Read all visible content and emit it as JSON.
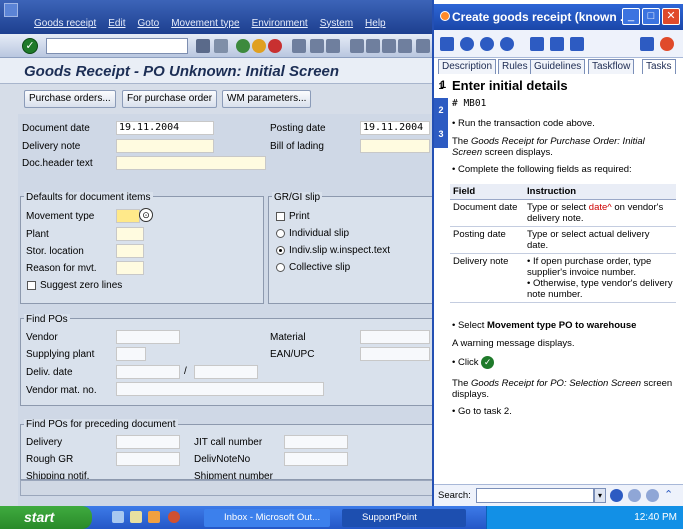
{
  "sap": {
    "menu": [
      "Goods receipt",
      "Edit",
      "Goto",
      "Movement type",
      "Environment",
      "System",
      "Help"
    ],
    "heading": "Goods Receipt - PO Unknown: Initial Screen",
    "buttons": [
      "Purchase orders...",
      "For purchase order",
      "WM parameters..."
    ],
    "fields": {
      "document_date_label": "Document date",
      "document_date": "19.11.2004",
      "posting_date_label": "Posting date",
      "posting_date": "19.11.2004",
      "delivery_note_label": "Delivery note",
      "bill_of_lading_label": "Bill of lading",
      "doc_header_label": "Doc.header text"
    },
    "defaults": {
      "title": "Defaults for document items",
      "movement_type": "Movement type",
      "plant": "Plant",
      "stor_location": "Stor. location",
      "reason": "Reason for mvt.",
      "suggest_zero": "Suggest zero lines"
    },
    "grgi": {
      "title": "GR/GI slip",
      "print": "Print",
      "individual": "Individual slip",
      "indiv_inspect": "Indiv.slip w.inspect.text",
      "collective": "Collective slip"
    },
    "find_pos": {
      "title": "Find POs",
      "vendor": "Vendor",
      "material": "Material",
      "supplying_plant": "Supplying plant",
      "ean": "EAN/UPC",
      "deliv_date": "Deliv. date",
      "slash": "/",
      "vendor_mat": "Vendor mat. no."
    },
    "find_preceding": {
      "title": "Find POs for preceding document",
      "delivery": "Delivery",
      "jit": "JIT call number",
      "rough_gr": "Rough GR",
      "delivnote": "DelivNoteNo",
      "shipping": "Shipping notif.",
      "shipment": "Shipment number"
    }
  },
  "help": {
    "title": "Create goods receipt (known ...",
    "tabs": [
      "Description",
      "Rules",
      "Guidelines",
      "Taskflow",
      "Tasks"
    ],
    "task_nums": [
      "1",
      "2",
      "3"
    ],
    "heading_num": "1",
    "heading": "Enter initial details",
    "tcode": "MB01",
    "run": "Run the transaction code above.",
    "the": "The ",
    "screen_name": "Goods Receipt for Purchase Order: Initial Screen",
    "displays": " screen displays.",
    "complete": "Complete the following fields as required:",
    "col_field": "Field",
    "col_instruction": "Instruction",
    "rows": [
      {
        "field": "Document date",
        "pre": "Type or select ",
        "red": "date^",
        " post": " on vendor's delivery note."
      },
      {
        "field": "Posting date",
        "text": "Type or select actual delivery date."
      },
      {
        "field": "Delivery note",
        "b1": "If open purchase order, type supplier's invoice number.",
        "b2": "Otherwise, type vendor's delivery note number."
      }
    ],
    "select_pre": "Select ",
    "select_bold": "Movement type PO to warehouse",
    "warning": "A warning message displays.",
    "click": "Click",
    "the2": "The ",
    "screen2": "Goods Receipt for PO: Selection Screen",
    "displays2": " screen displays.",
    "goto": "Go to task 2.",
    "search_label": "Search:"
  },
  "taskbar": {
    "start": "start",
    "tasks": [
      "Inbox - Microsoft Out...",
      "SupportPoint"
    ],
    "clock": "12:40 PM"
  }
}
